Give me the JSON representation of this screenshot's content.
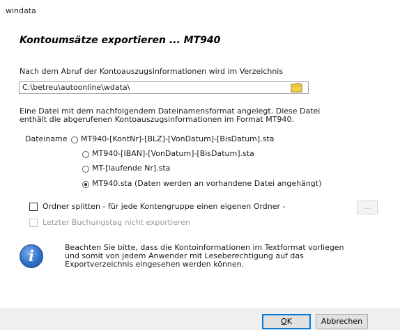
{
  "window": {
    "title": "windata"
  },
  "dialog": {
    "heading": "Kontoumsätze exportieren ... MT940",
    "intro_text": "Nach dem Abruf der Kontoauszugsinformationen wird im Verzeichnis",
    "path_value": "C:\\betreu\\autoonline\\wdata\\",
    "desc_line1": "Eine Datei mit dem nachfolgendem Dateinamensformat angelegt. Diese Datei",
    "desc_line2": "enthält die abgerufenen Kontoauszugsinformationen im Format MT940.",
    "filename_label": "Dateiname",
    "filename_options": [
      {
        "label": "MT940-[KontNr]-[BLZ]-[VonDatum]-[BisDatum].sta",
        "selected": false
      },
      {
        "label": "MT940-[IBAN]-[VonDatum]-[BisDatum].sta",
        "selected": false
      },
      {
        "label": "MT-[laufende Nr].sta",
        "selected": false
      },
      {
        "label": "MT940.sta (Daten werden an vorhandene Datei angehängt)",
        "selected": true
      }
    ],
    "split_folder_label": "Ordner splitten - für jede Kontengruppe einen eigenen Ordner -",
    "split_folder_checked": false,
    "ellipsis_label": "...",
    "last_day_label": "Letzter Buchungstag nicht exportieren",
    "last_day_checked": false,
    "last_day_enabled": false,
    "info_icon": "i",
    "info_line1": "Beachten Sie bitte, dass die Kontoinformationen im Textformat vorliegen",
    "info_line2": "und somit von jedem Anwender mit Leseberechtigung auf das",
    "info_line3": "Exportverzeichnis eingesehen werden können."
  },
  "buttons": {
    "ok": "OK",
    "cancel": "Abbrechen"
  },
  "colors": {
    "info_blue": "#2f6fc7",
    "folder_yellow": "#f3d04f",
    "footer_bg": "#f0f0f0",
    "focus_border": "#0078d7"
  }
}
